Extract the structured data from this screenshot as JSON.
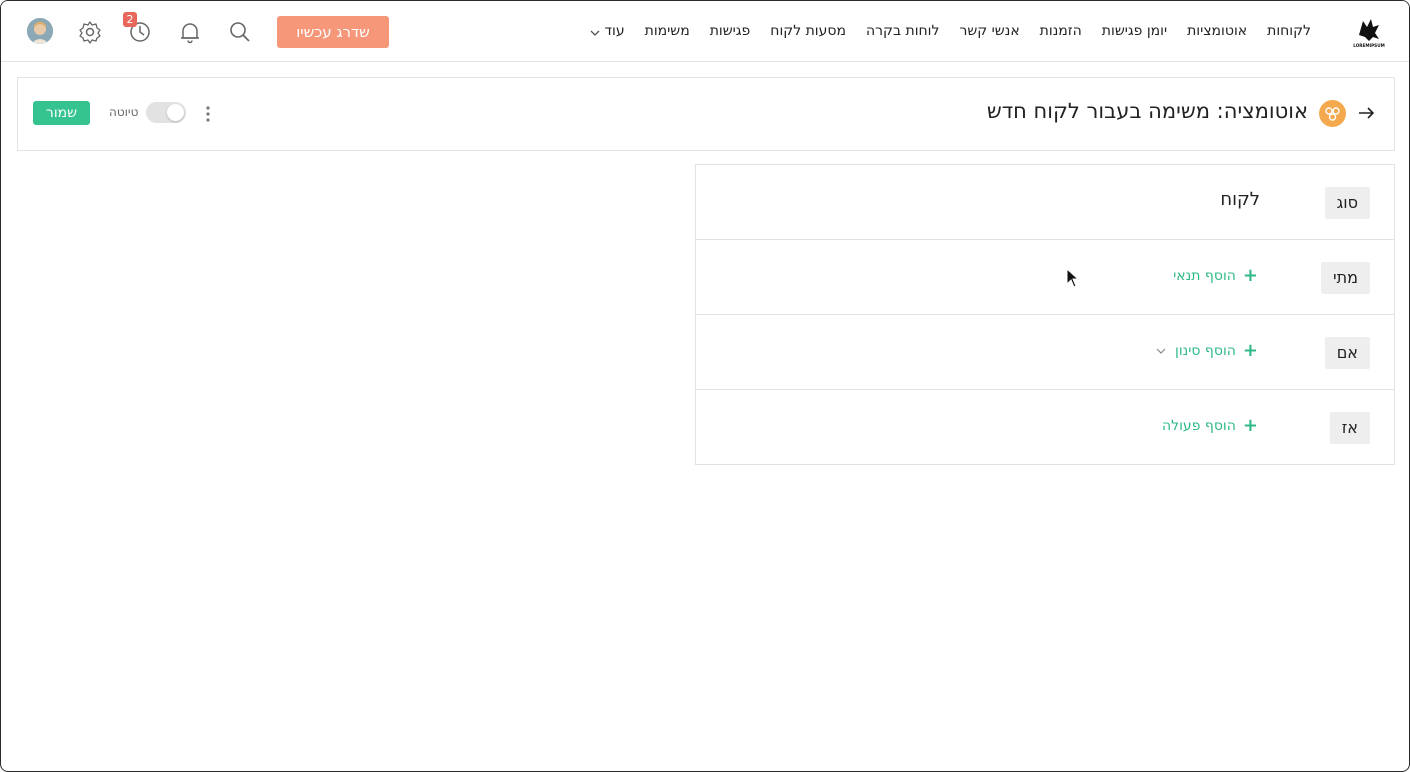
{
  "nav": {
    "items": [
      "לקוחות",
      "אוטומציות",
      "יומן פגישות",
      "הזמנות",
      "אנשי קשר",
      "לוחות בקרה",
      "מסעות לקוח",
      "פגישות",
      "משימות"
    ],
    "more_label": "עוד",
    "upgrade_label": "שדרג עכשיו",
    "history_badge": "2",
    "logo_text": "LOREMIPSUM",
    "icons": [
      "search-icon",
      "bell-icon",
      "history-icon",
      "gear-icon"
    ]
  },
  "header": {
    "title": "אוטומציה: משימה בעבור לקוח חדש",
    "draft_label": "טיוטה",
    "draft_enabled": false,
    "save_label": "שמור"
  },
  "rules": {
    "type": {
      "label": "סוג",
      "value": "לקוח"
    },
    "when": {
      "label": "מתי",
      "add_label": "הוסף תנאי"
    },
    "if": {
      "label": "אם",
      "add_label": "הוסף סינון"
    },
    "then": {
      "label": "אז",
      "add_label": "הוסף פעולה"
    }
  },
  "colors": {
    "upgrade": "#f7977a",
    "save": "#35c48f",
    "link": "#2fb985",
    "badge": "#e8665c",
    "automation_icon": "#f5a94f"
  }
}
